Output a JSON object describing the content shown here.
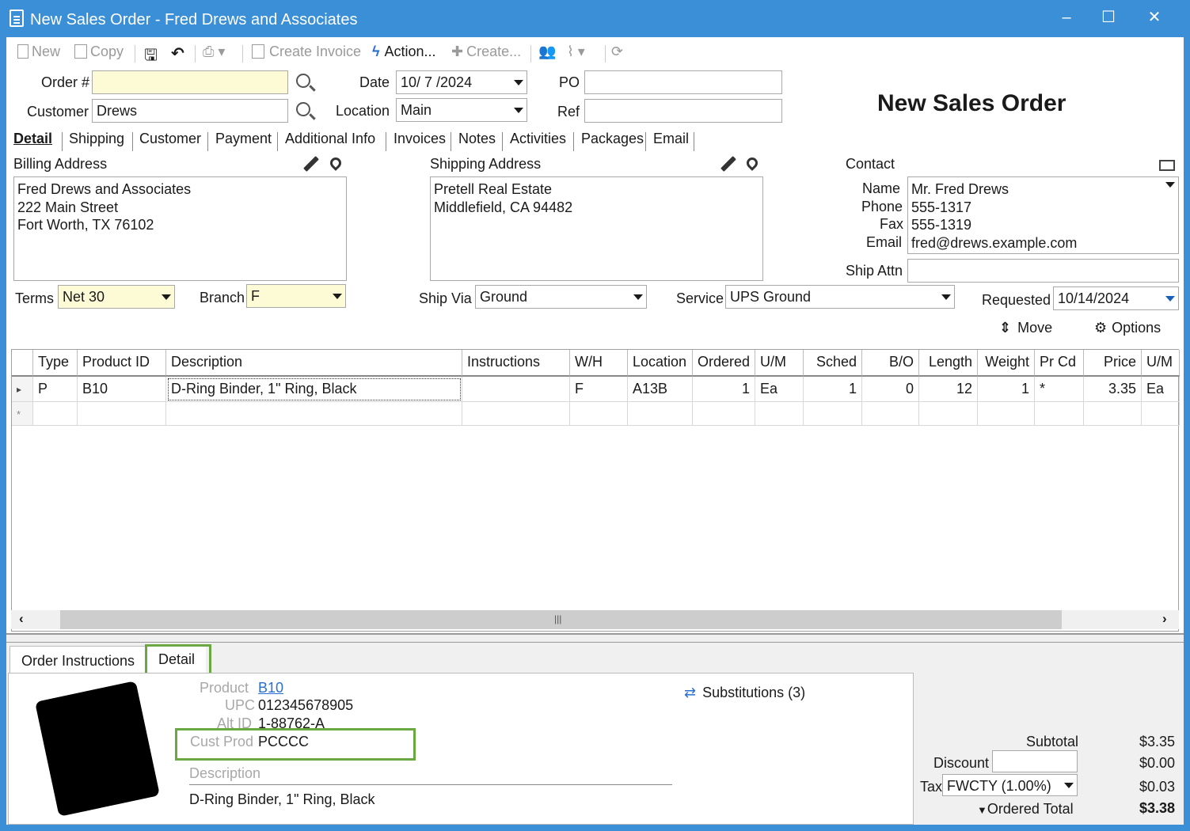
{
  "window": {
    "title": "New Sales Order - Fred Drews and Associates",
    "min": "–",
    "max": "☐",
    "close": "✕"
  },
  "toolbar": {
    "new": "New",
    "copy": "Copy",
    "save_icon": "save-icon",
    "undo_icon": "undo-icon",
    "print_icon": "printer-icon",
    "create_invoice": "Create Invoice",
    "action": "Action...",
    "create": "Create...",
    "users_icon": "users-icon",
    "attach_icon": "paperclip-icon",
    "refresh_icon": "refresh-icon"
  },
  "header": {
    "order_label": "Order #",
    "order_value": "",
    "customer_label": "Customer",
    "customer_value": "Drews",
    "date_label": "Date",
    "date_value": "10/ 7 /2024",
    "location_label": "Location",
    "location_value": "Main",
    "po_label": "PO",
    "po_value": "",
    "ref_label": "Ref",
    "ref_value": "",
    "page_title": "New Sales Order"
  },
  "tabs": [
    "Detail",
    "Shipping",
    "Customer",
    "Payment",
    "Additional Info",
    "Invoices",
    "Notes",
    "Activities",
    "Packages",
    "Email"
  ],
  "billing": {
    "label": "Billing Address",
    "lines": [
      "Fred Drews and Associates",
      "222 Main Street",
      "Fort Worth, TX 76102"
    ]
  },
  "shipping": {
    "label": "Shipping Address",
    "lines": [
      "Pretell Real Estate",
      "Middlefield, CA 94482"
    ]
  },
  "contact": {
    "label": "Contact",
    "name_label": "Name",
    "name": "Mr. Fred Drews",
    "phone_label": "Phone",
    "phone": "555-1317",
    "fax_label": "Fax",
    "fax": "555-1319",
    "email_label": "Email",
    "email": "fred@drews.example.com",
    "ship_attn_label": "Ship Attn",
    "ship_attn": ""
  },
  "terms": {
    "label": "Terms",
    "value": "Net 30"
  },
  "branch": {
    "label": "Branch",
    "value": "F"
  },
  "ship_via": {
    "label": "Ship Via",
    "value": "Ground"
  },
  "service": {
    "label": "Service",
    "value": "UPS Ground"
  },
  "requested": {
    "label": "Requested",
    "value": "10/14/2024"
  },
  "move_label": "Move",
  "options_label": "Options",
  "grid": {
    "columns": [
      "Type",
      "Product ID",
      "Description",
      "Instructions",
      "W/H",
      "Location",
      "Ordered",
      "U/M",
      "Sched",
      "B/O",
      "Length",
      "Weight",
      "Pr Cd",
      "Price",
      "U/M"
    ],
    "rows": [
      [
        "P",
        "B10",
        "D-Ring Binder, 1\" Ring, Black",
        "",
        "F",
        "A13B",
        "1",
        "Ea",
        "1",
        "0",
        "12",
        "1",
        "*",
        "3.35",
        "Ea"
      ]
    ],
    "row_marker": "▸",
    "new_row_marker": "*"
  },
  "bottom_tabs": [
    "Order Instructions",
    "Detail"
  ],
  "detail": {
    "product_label": "Product",
    "product": "B10",
    "upc_label": "UPC",
    "upc": "012345678905",
    "alt_id_label": "Alt ID",
    "alt_id": "1-88762-A",
    "cust_prod_label": "Cust Prod",
    "cust_prod": "PCCCC",
    "description_label": "Description",
    "description": "D-Ring Binder, 1\" Ring, Black",
    "substitutions": "Substitutions (3)"
  },
  "totals": {
    "subtotal_label": "Subtotal",
    "subtotal": "$3.35",
    "discount_label": "Discount",
    "discount_input": "",
    "discount": "$0.00",
    "tax_label": "Tax",
    "tax_code": "FWCTY (1.00%)",
    "tax": "$0.03",
    "ordered_total_label": "Ordered Total",
    "ordered_total": "$3.38"
  }
}
